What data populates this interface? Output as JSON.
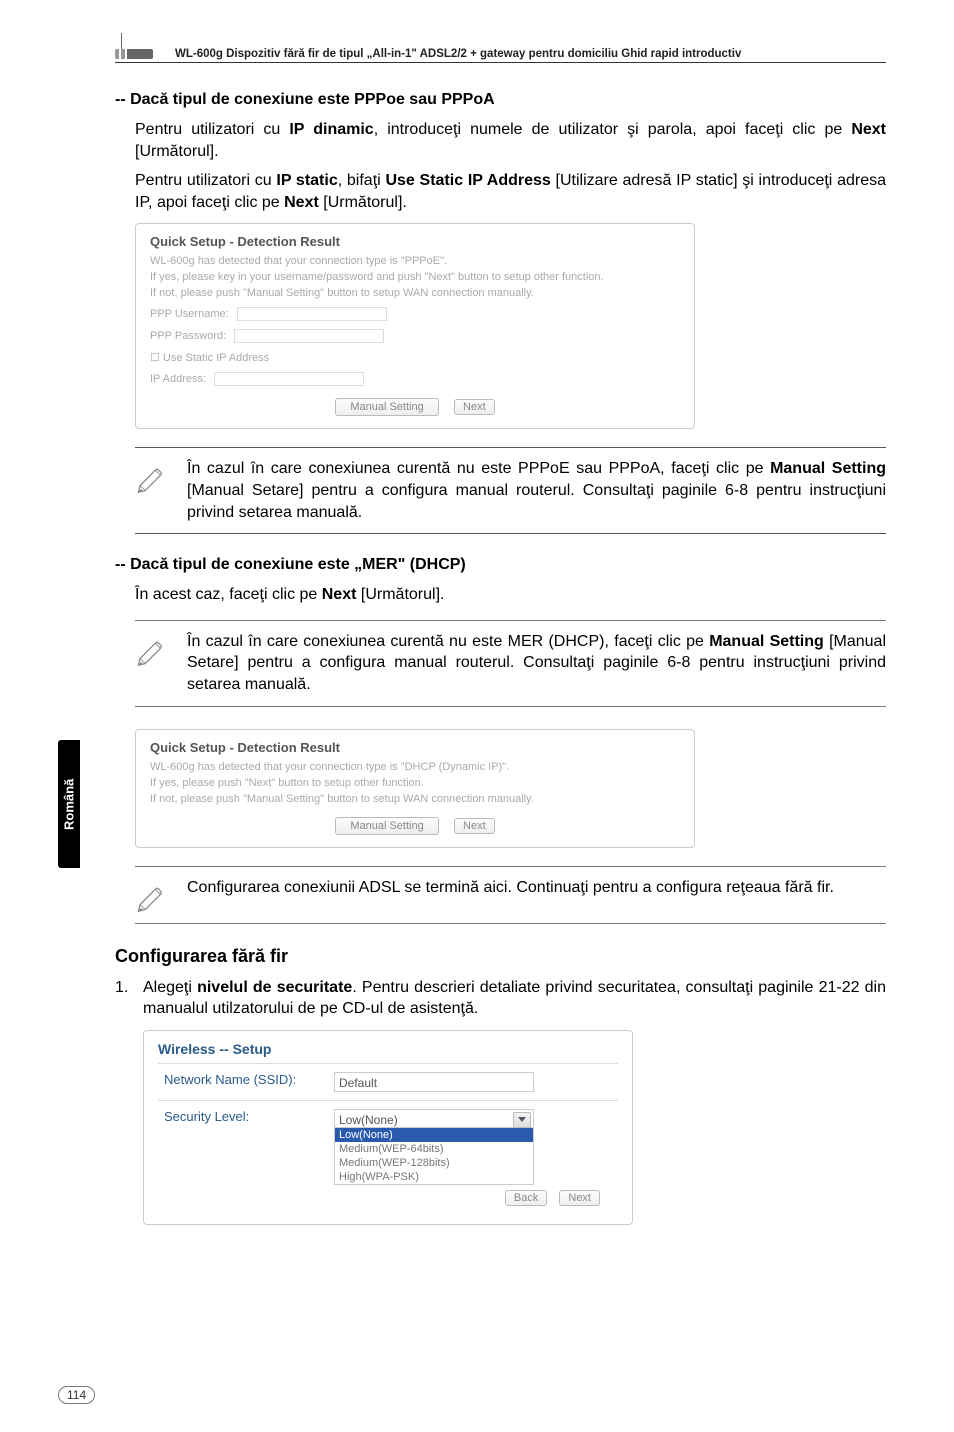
{
  "header": {
    "product_line": "WL-600g Dispozitiv fără fir de tipul „All-in-1\" ADSL2/2 + gateway pentru domiciliu Ghid rapid introductiv"
  },
  "sidebar": {
    "lang": "Română"
  },
  "s1": {
    "heading": "-- Dacă tipul de conexiune este PPPoe sau PPPoA",
    "p1_a": "Pentru utilizatori cu ",
    "p1_b": "IP dinamic",
    "p1_c": ", introduceţi numele de utilizator şi parola, apoi faceţi clic pe ",
    "p1_d": "Next",
    "p1_e": " [Următorul].",
    "p2_a": "Pentru utilizatori cu ",
    "p2_b": "IP static",
    "p2_c": ", bifaţi ",
    "p2_d": "Use Static IP Address",
    "p2_e": " [Utilizare adresă IP static] şi introduceţi adresa IP, apoi faceţi clic pe ",
    "p2_f": "Next",
    "p2_g": " [Următorul]."
  },
  "shot1": {
    "title": "Quick Setup - Detection Result",
    "l1": "WL-600g has detected that your connection type is \"PPPoE\".",
    "l2": "If yes, please key in your username/password and push \"Next\" button to setup other function.",
    "l3": "If not, please push \"Manual Setting\" button to setup WAN connection manually.",
    "f1": "PPP Username:",
    "f2": "PPP Password:",
    "f3": "Use Static IP Address",
    "f4": "IP Address:",
    "b1": "Manual Setting",
    "b2": "Next"
  },
  "note1": {
    "a": "În cazul în care conexiunea curentă nu este PPPoE sau PPPoA, faceţi clic pe ",
    "b": "Manual Setting",
    "c": " [Manual Setare] pentru a configura manual routerul. Consultaţi paginile 6-8 pentru instrucţiuni privind setarea manuală."
  },
  "s2": {
    "heading": "-- Dacă tipul de conexiune este „MER\" (DHCP)",
    "p1_a": "În acest caz, faceţi clic pe ",
    "p1_b": "Next",
    "p1_c": " [Următorul]."
  },
  "note2": {
    "a": "În cazul în care conexiunea curentă nu este MER (DHCP), faceţi clic pe ",
    "b": "Manual Setting",
    "c": " [Manual Setare] pentru a configura manual routerul. Consultaţi paginile 6-8 pentru instrucţiuni privind setarea manuală."
  },
  "shot2": {
    "title": "Quick Setup - Detection Result",
    "l1": "WL-600g has detected that your connection type is \"DHCP (Dynamic IP)\".",
    "l2": "If yes, please push \"Next\" button to setup other function.",
    "l3": "If not, please push \"Manual Setting\" button to setup WAN connection manually.",
    "b1": "Manual Setting",
    "b2": "Next"
  },
  "note3": {
    "text": "Configurarea conexiunii ADSL se termină aici. Continuaţi pentru a configura reţeaua fără fir."
  },
  "s3": {
    "heading": "Configurarea fără fir",
    "li_num": "1.",
    "li_a": "Alegeţi ",
    "li_b": "nivelul de securitate",
    "li_c": ". Pentru descrieri detaliate privind securitatea, consultaţi paginile 21-22 din manualul utilzatorului de pe CD-ul de asistenţă."
  },
  "wireless": {
    "title": "Wireless -- Setup",
    "ssid_label": "Network Name (SSID):",
    "ssid_value": "Default",
    "sec_label": "Security Level:",
    "sec_top": "Low(None)",
    "opts": [
      "Low(None)",
      "Medium(WEP-64bits)",
      "Medium(WEP-128bits)",
      "High(WPA-PSK)"
    ],
    "back": "Back",
    "next": "Next"
  },
  "page_no": "114"
}
